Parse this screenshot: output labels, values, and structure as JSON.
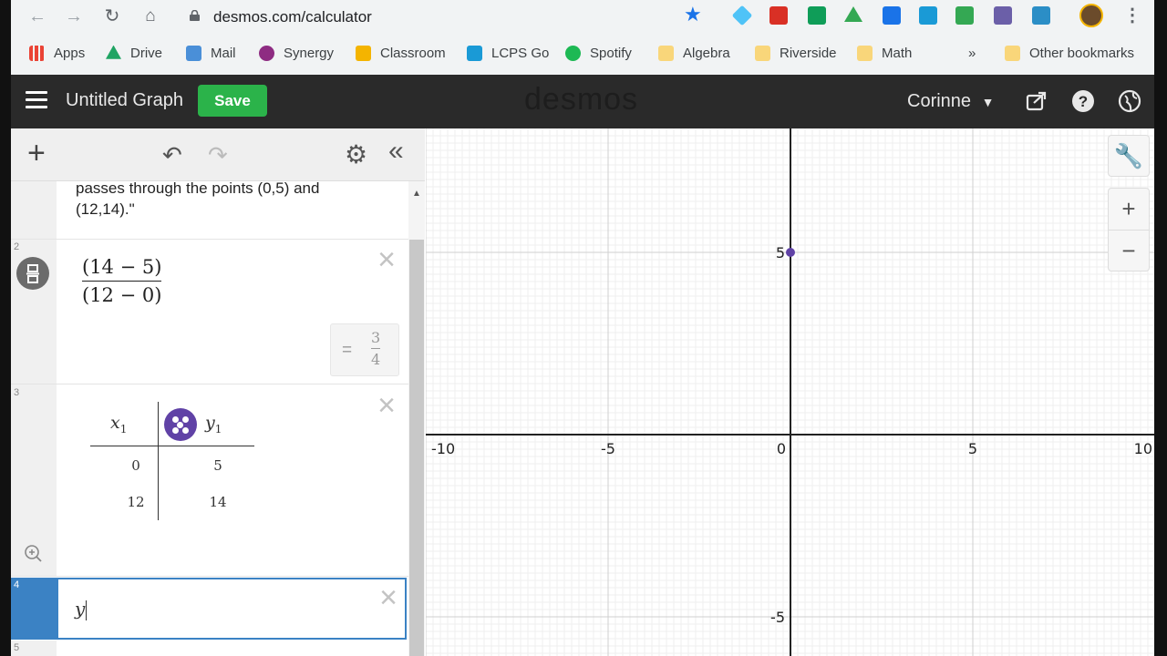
{
  "browser": {
    "url": "desmos.com/calculator",
    "bookmarks": [
      {
        "label": "Apps",
        "color": "#ea4335"
      },
      {
        "label": "Drive",
        "color": "#1fa463"
      },
      {
        "label": "Mail",
        "color": "#4a8fd8"
      },
      {
        "label": "Synergy",
        "color": "#8e2c82"
      },
      {
        "label": "Classroom",
        "color": "#f4b400"
      },
      {
        "label": "LCPS Go",
        "color": "#1a9ad6"
      },
      {
        "label": "Spotify",
        "color": "#1db954"
      },
      {
        "label": "Algebra",
        "color": "#f9d67a"
      },
      {
        "label": "Riverside",
        "color": "#f9d67a"
      },
      {
        "label": "Math",
        "color": "#f9d67a"
      }
    ],
    "overflow": "»",
    "other_bookmarks": "Other bookmarks"
  },
  "header": {
    "title": "Untitled Graph",
    "save_label": "Save",
    "logo": "desmos",
    "user": "Corinne",
    "save_color": "#2bb34a"
  },
  "expressions": {
    "note": {
      "text": "passes through the points (0,5) and (12,14).\""
    },
    "slope": {
      "rownum": "2",
      "numerator": "(14 − 5)",
      "denominator": "(12 − 0)",
      "result_eq": "=",
      "result_num": "3",
      "result_den": "4"
    },
    "table": {
      "rownum": "3",
      "col_x": "x",
      "col_x_sub": "1",
      "col_y": "y",
      "col_y_sub": "1",
      "rows": [
        [
          "0",
          "5"
        ],
        [
          "12",
          "14"
        ]
      ],
      "point_color": "#6042a6"
    },
    "active": {
      "rownum": "4",
      "value": "y"
    },
    "next_rownum": "5"
  },
  "graph": {
    "x_ticks": [
      "-10",
      "-5",
      "0",
      "5",
      "10"
    ],
    "y_ticks": [
      "5",
      "-5"
    ],
    "point": {
      "x": 0,
      "y": 5
    },
    "point_color": "#6042a6"
  }
}
